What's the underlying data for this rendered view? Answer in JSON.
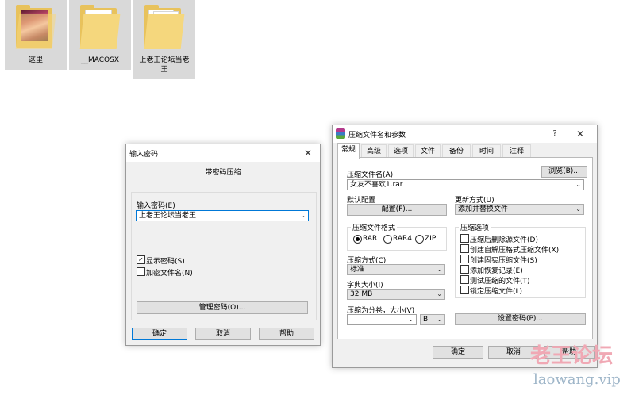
{
  "desktop": {
    "icons": [
      {
        "label": "这里",
        "type": "photo-folder-icon"
      },
      {
        "label": "__MACOSX",
        "type": "folder-icon"
      },
      {
        "label": "上老王论坛当老王",
        "type": "folder-icon"
      }
    ]
  },
  "password_dialog": {
    "title": "输入密码",
    "heading": "带密码压缩",
    "password_label": "输入密码(E)",
    "password_value": "上老王论坛当老王",
    "show_password": {
      "label": "显示密码(S)",
      "checked": true
    },
    "encrypt_names": {
      "label": "加密文件名(N)",
      "checked": false
    },
    "manage_button": "管理密码(O)...",
    "ok": "确定",
    "cancel": "取消",
    "help": "帮助"
  },
  "archive_dialog": {
    "title": "压缩文件名和参数",
    "help_glyph": "?",
    "tabs": [
      "常规",
      "高级",
      "选项",
      "文件",
      "备份",
      "时间",
      "注释"
    ],
    "active_tab": "常规",
    "archive_name_label": "压缩文件名(A)",
    "browse_button": "浏览(B)...",
    "archive_name_value": "女友不喜欢1.rar",
    "default_profile_label": "默认配置",
    "profile_button": "配置(F)...",
    "update_mode_label": "更新方式(U)",
    "update_mode_value": "添加并替换文件",
    "format_group": "压缩文件格式",
    "formats": [
      {
        "label": "RAR",
        "selected": true
      },
      {
        "label": "RAR4",
        "selected": false
      },
      {
        "label": "ZIP",
        "selected": false
      }
    ],
    "options_group": "压缩选项",
    "options": [
      {
        "label": "压缩后删除源文件(D)",
        "checked": false
      },
      {
        "label": "创建自解压格式压缩文件(X)",
        "checked": false
      },
      {
        "label": "创建固实压缩文件(S)",
        "checked": false
      },
      {
        "label": "添加恢复记录(E)",
        "checked": false
      },
      {
        "label": "测试压缩的文件(T)",
        "checked": false
      },
      {
        "label": "锁定压缩文件(L)",
        "checked": false
      }
    ],
    "method_label": "压缩方式(C)",
    "method_value": "标准",
    "dict_label": "字典大小(I)",
    "dict_value": "32 MB",
    "split_label": "压缩为分卷，大小(V)",
    "split_value": "",
    "split_unit": "B",
    "set_password_button": "设置密码(P)...",
    "ok": "确定",
    "cancel": "取消",
    "help": "帮助"
  },
  "watermark": {
    "line1": "老王论坛",
    "line2": "laowang.vip"
  }
}
